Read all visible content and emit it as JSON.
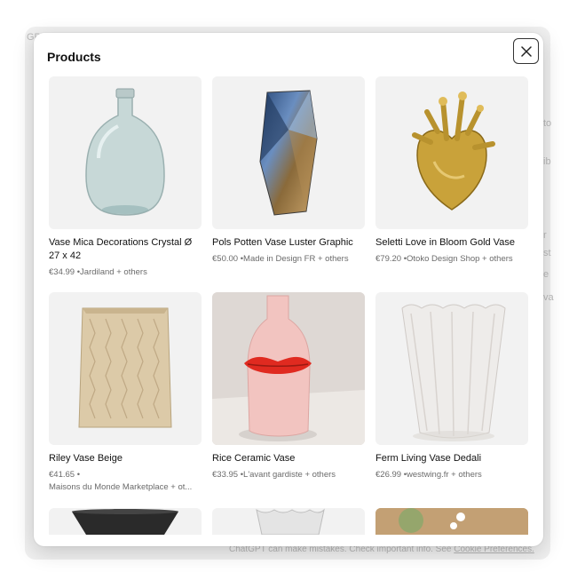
{
  "modal": {
    "title": "Products",
    "close_label": "Close"
  },
  "footer": {
    "note": "ChatGPT can make mistakes. Check important info. See ",
    "link": "Cookie Preferences."
  },
  "background_fragments": [
    "GPT",
    "to",
    "ib",
    "r",
    "st",
    "e",
    "va"
  ],
  "products": [
    {
      "name": "Vase Mica Decorations Crystal Ø 27 x 42",
      "price": "€34.99",
      "sellers": "Jardiland + others"
    },
    {
      "name": "Pols Potten Vase Luster Graphic",
      "price": "€50.00",
      "sellers": "Made in Design FR + others"
    },
    {
      "name": "Seletti Love in Bloom Gold Vase",
      "price": "€79.20",
      "sellers": "Otoko Design Shop + others"
    },
    {
      "name": "Riley Vase Beige",
      "price": "€41.65",
      "sellers": "Maisons du Monde Marketplace + ot..."
    },
    {
      "name": "Rice Ceramic Vase",
      "price": "€33.95",
      "sellers": "L'avant gardiste + others"
    },
    {
      "name": "Ferm Living Vase Dedali",
      "price": "€26.99",
      "sellers": "westwing.fr + others"
    }
  ],
  "icons": {
    "close": "close-icon"
  }
}
